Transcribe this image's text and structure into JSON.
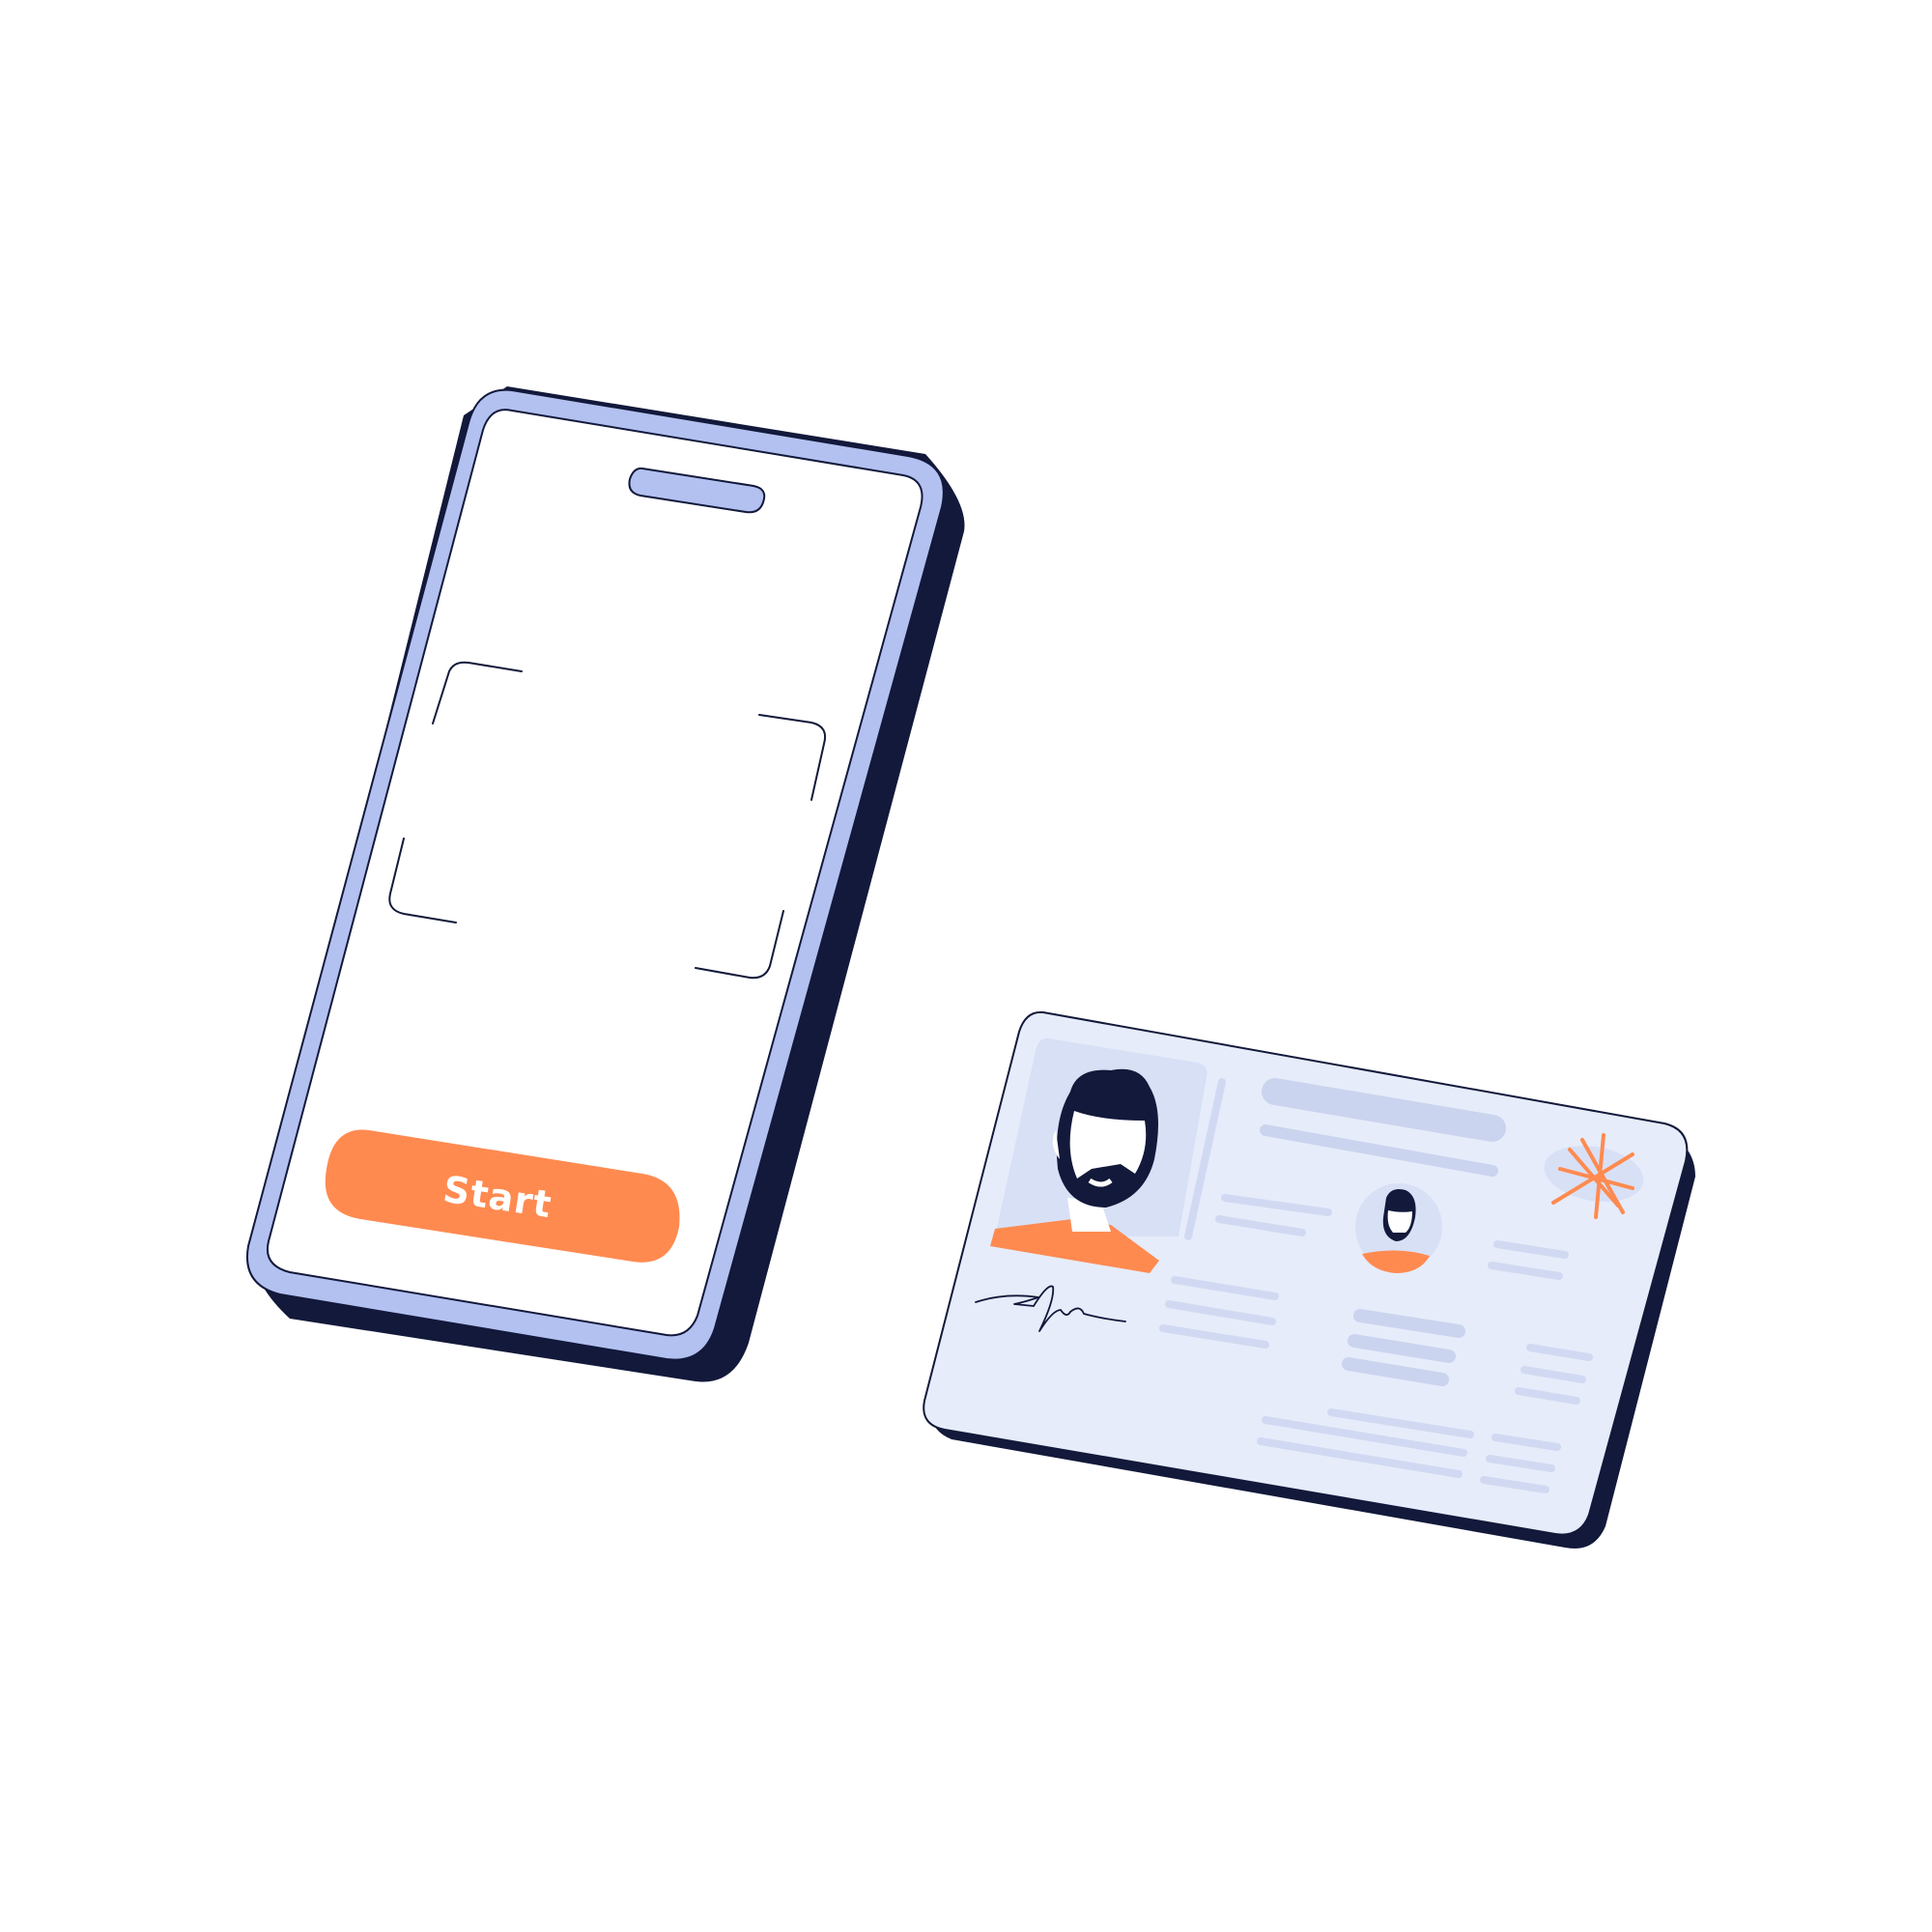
{
  "phone": {
    "start_button_label": "Start"
  },
  "icons": {
    "phone_notch": "pill-notch",
    "viewfinder": "scan-frame-corners",
    "id_portrait": "bearded-man-portrait",
    "id_small_portrait": "bearded-man-mini-portrait",
    "signature": "handwritten-signature",
    "seal": "starburst-seal"
  },
  "colors": {
    "navy": "#12193A",
    "periwinkle": "#B3C1F1",
    "accent_orange": "#FF8A50",
    "card_fill": "#E6ECFA",
    "card_lines": "#CBD4EE",
    "white": "#FFFFFF"
  }
}
